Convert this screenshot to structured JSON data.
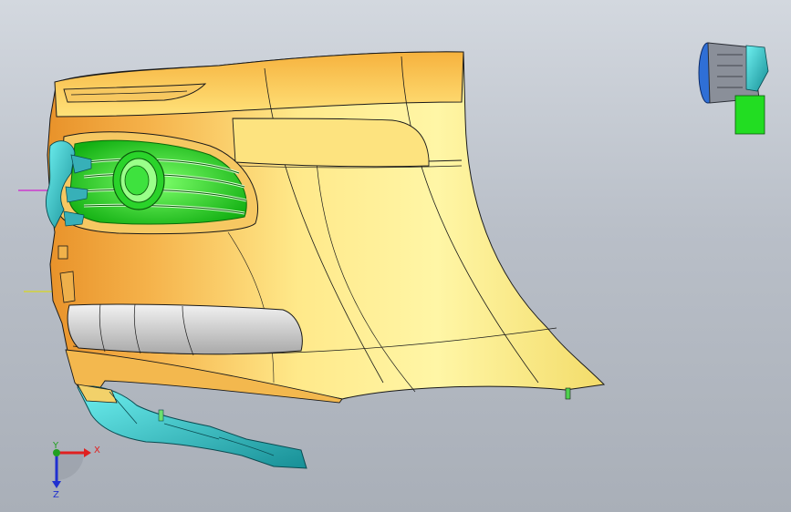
{
  "viewport": {
    "background_top": "#d3d8df",
    "background_bottom": "#a9afb8"
  },
  "model": {
    "bumper_color": "#f5c65a",
    "bumper_highlight": "#fff5a8",
    "bumper_shadow": "#e79a2c",
    "foglight_housing_color": "#22dd22",
    "bracket_color": "#27c2c2",
    "trim_strip_color": "#d9d9d9",
    "edge_color": "#1a1a1a"
  },
  "orientation_triad": {
    "x_label": "X",
    "y_label": "Y",
    "z_label": "Z",
    "x_color": "#e02020",
    "y_color": "#20a020",
    "z_color": "#2030d0"
  },
  "reference_lines": {
    "upper_color": "#d020d0",
    "lower_color": "#d8d820"
  }
}
